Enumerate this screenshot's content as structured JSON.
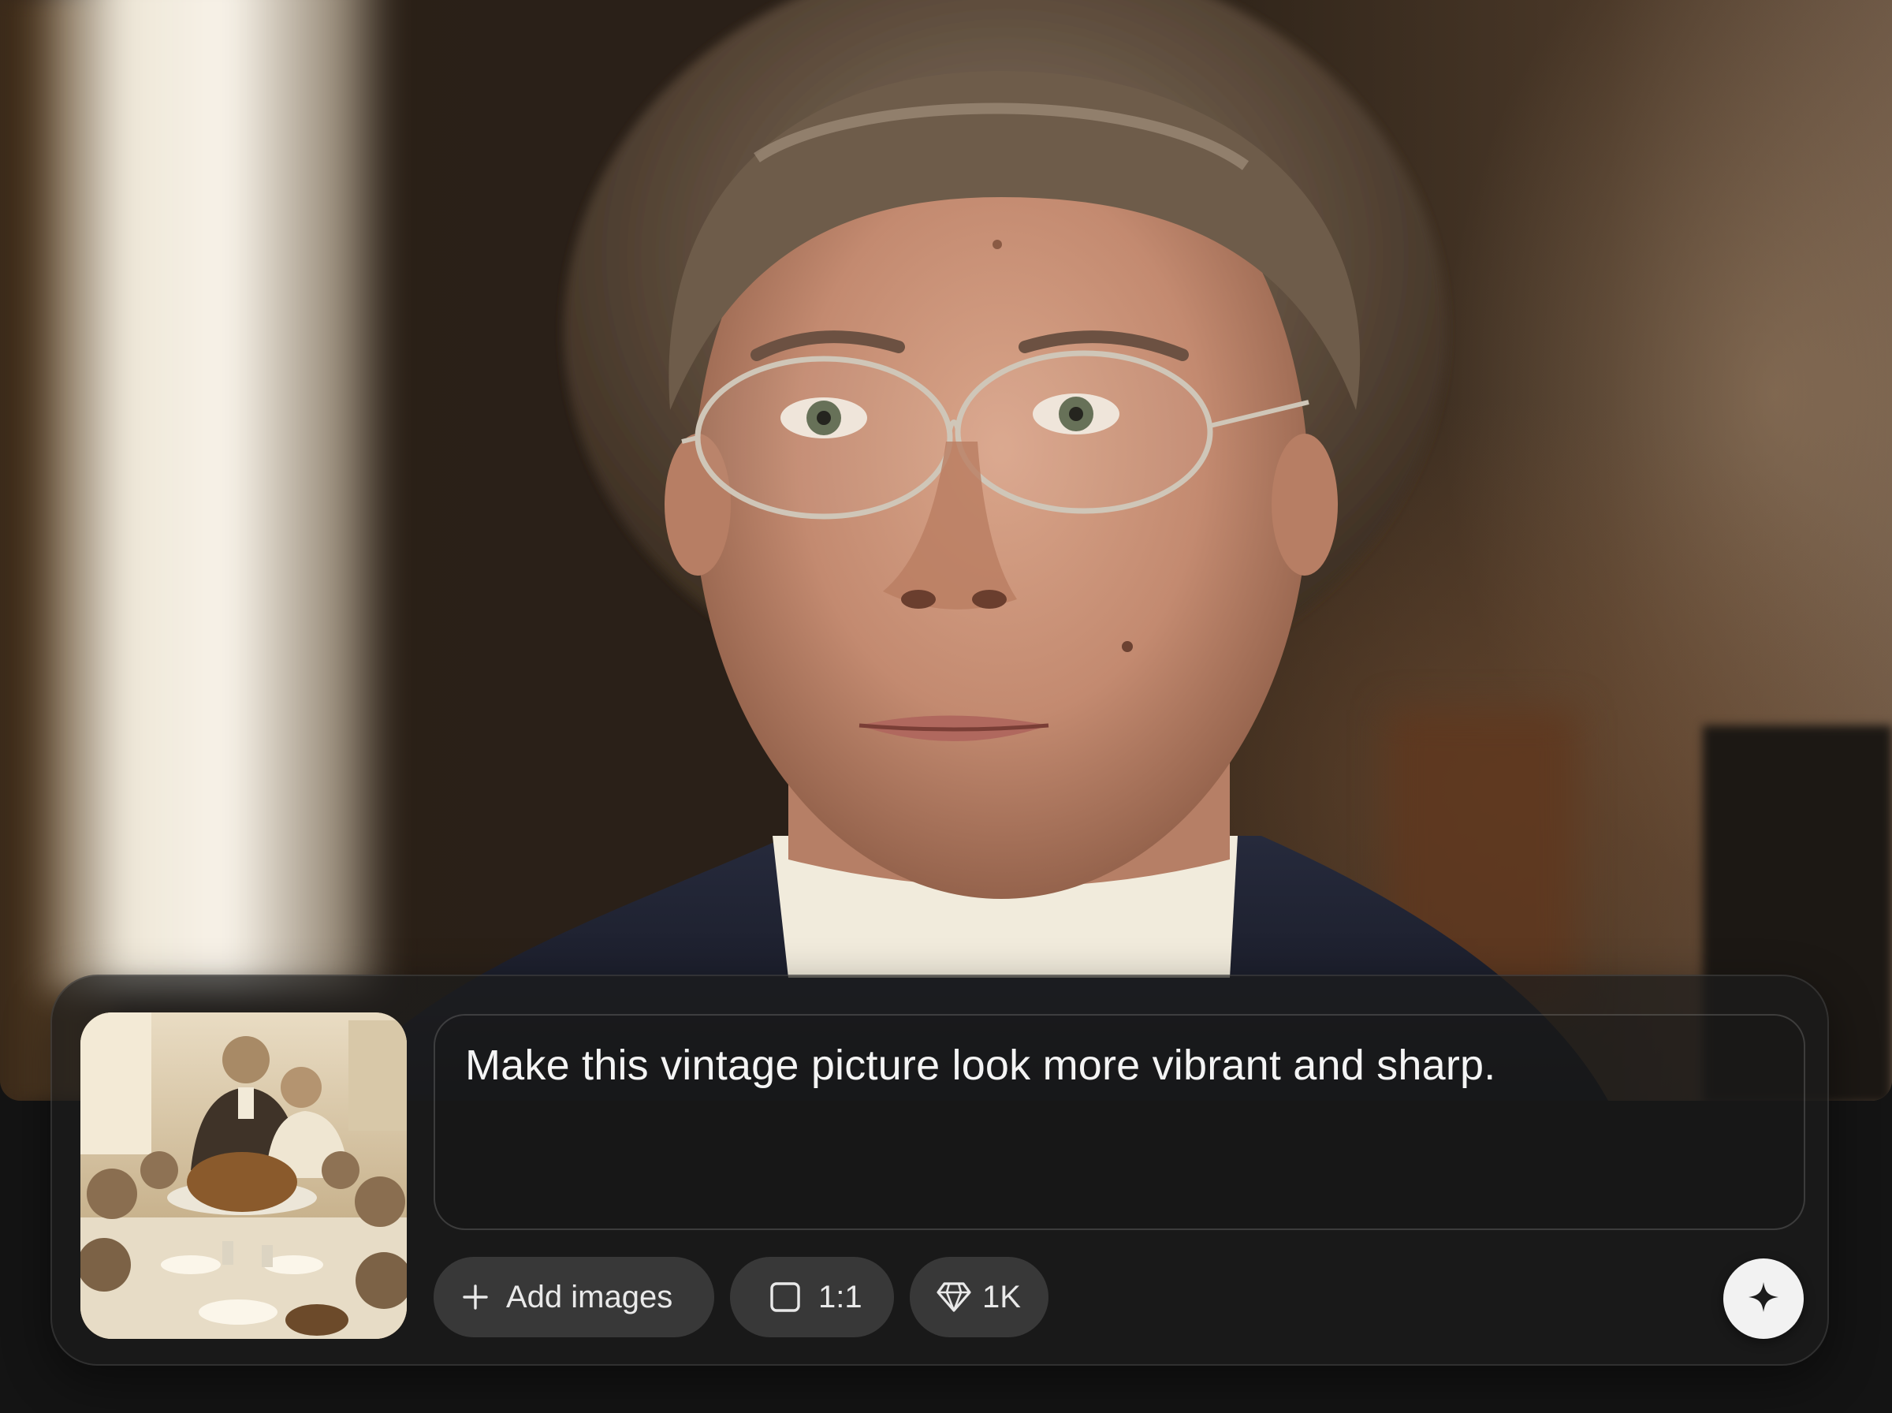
{
  "hero": {
    "subject": "hero-photo",
    "colors": {
      "background": "#2b2117",
      "window_light": "#fff8e8",
      "coat": "#1e2130",
      "skin": "#c9937a"
    }
  },
  "composer": {
    "thumbnail_icon": "thumbnail-image",
    "prompt_text": "Make this vintage picture look more vibrant and sharp.",
    "add_images": {
      "icon": "plus-icon",
      "label": "Add images"
    },
    "aspect_ratio": {
      "icon": "square-icon",
      "label": "1:1"
    },
    "resolution": {
      "icon": "diamond-icon",
      "label": "1K"
    },
    "generate": {
      "icon": "sparkle-icon"
    }
  }
}
